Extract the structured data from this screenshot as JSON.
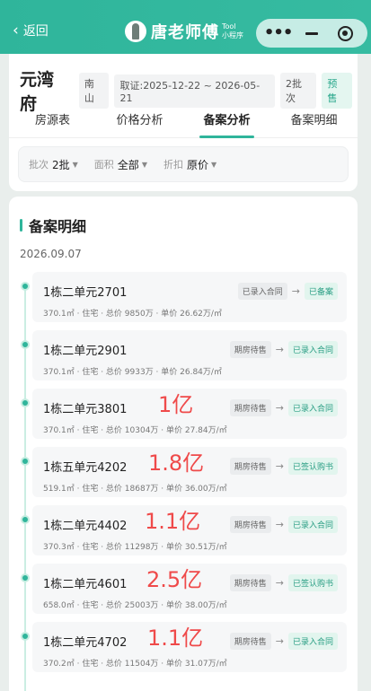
{
  "header": {
    "back_label": "返回",
    "brand_name": "唐老师傅",
    "brand_sub_top": "Tool",
    "brand_sub_bottom": "小程序"
  },
  "project": {
    "name": "元湾府",
    "chips": [
      "南山",
      "取证:2025-12-22 ~ 2026-05-21",
      "2批次",
      "预售"
    ]
  },
  "tabs": [
    "房源表",
    "价格分析",
    "备案分析",
    "备案明细"
  ],
  "active_tab": 2,
  "filters": [
    {
      "label": "批次",
      "value": "2批"
    },
    {
      "label": "面积",
      "value": "全部"
    },
    {
      "label": "折扣",
      "value": "原价"
    }
  ],
  "section_title": "备案明细",
  "date": "2026.09.07",
  "entries": [
    {
      "unit": "1栋二单元2701",
      "meta": "370.1㎡ · 住宅 · 总价 9850万 · 单价 26.62万/㎡",
      "from": "已录入合同",
      "to": "已备案",
      "note": ""
    },
    {
      "unit": "1栋二单元2901",
      "meta": "370.1㎡ · 住宅 · 总价 9933万 · 单价 26.84万/㎡",
      "from": "期房待售",
      "to": "已录入合同",
      "note": ""
    },
    {
      "unit": "1栋二单元3801",
      "meta": "370.1㎡ · 住宅 · 总价 10304万 · 单价 27.84万/㎡",
      "from": "期房待售",
      "to": "已录入合同",
      "note": "1亿"
    },
    {
      "unit": "1栋五单元4202",
      "meta": "519.1㎡ · 住宅 · 总价 18687万 · 单价 36.00万/㎡",
      "from": "期房待售",
      "to": "已签认购书",
      "note": "1.8亿"
    },
    {
      "unit": "1栋二单元4402",
      "meta": "370.3㎡ · 住宅 · 总价 11298万 · 单价 30.51万/㎡",
      "from": "期房待售",
      "to": "已录入合同",
      "note": "1.1亿"
    },
    {
      "unit": "1栋二单元4601",
      "meta": "658.0㎡ · 住宅 · 总价 25003万 · 单价 38.00万/㎡",
      "from": "期房待售",
      "to": "已签认购书",
      "note": "2.5亿"
    },
    {
      "unit": "1栋二单元4702",
      "meta": "370.2㎡ · 住宅 · 总价 11504万 · 单价 31.07万/㎡",
      "from": "期房待售",
      "to": "已录入合同",
      "note": "1.1亿"
    }
  ],
  "colors": {
    "accent": "#2fb59b",
    "note_red": "#ef4a4a"
  }
}
